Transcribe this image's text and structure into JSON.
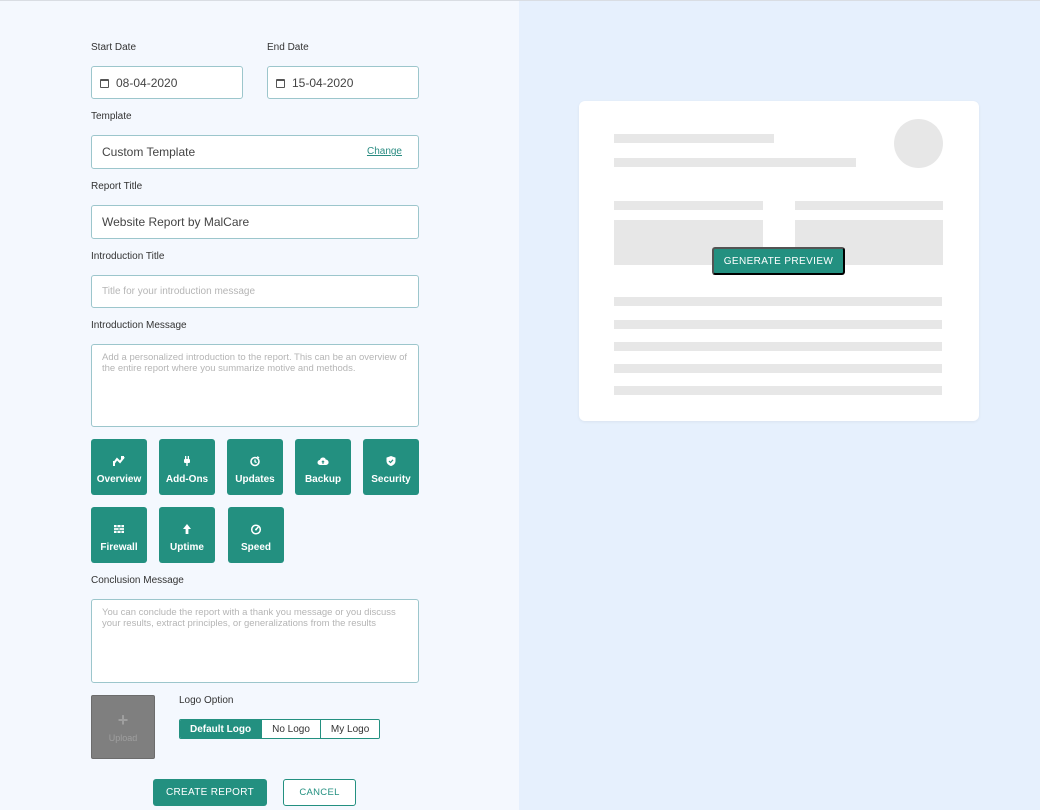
{
  "form": {
    "start_date_label": "Start Date",
    "start_date_value": "08-04-2020",
    "end_date_label": "End Date",
    "end_date_value": "15-04-2020",
    "template_label": "Template",
    "template_value": "Custom Template",
    "template_change": "Change",
    "report_title_label": "Report Title",
    "report_title_value": "Website Report by MalCare",
    "intro_title_label": "Introduction Title",
    "intro_title_placeholder": "Title for your introduction message",
    "intro_message_label": "Introduction Message",
    "intro_message_placeholder": "Add a personalized introduction to the report. This can be an overview of the entire report where you summarize motive and methods.",
    "conclusion_label": "Conclusion Message",
    "conclusion_placeholder": "You can conclude the report with a thank you message or you discuss your results, extract principles, or generalizations from the results"
  },
  "sections": [
    {
      "label": "Overview",
      "icon": "chart-icon"
    },
    {
      "label": "Add-Ons",
      "icon": "plug-icon"
    },
    {
      "label": "Updates",
      "icon": "refresh-icon"
    },
    {
      "label": "Backup",
      "icon": "cloud-icon"
    },
    {
      "label": "Security",
      "icon": "shield-icon"
    },
    {
      "label": "Firewall",
      "icon": "firewall-icon"
    },
    {
      "label": "Uptime",
      "icon": "arrow-up-icon"
    },
    {
      "label": "Speed",
      "icon": "speedometer-icon"
    }
  ],
  "logo": {
    "upload_label": "Upload",
    "option_label": "Logo Option",
    "options": [
      "Default Logo",
      "No Logo",
      "My Logo"
    ],
    "selected": "Default Logo"
  },
  "actions": {
    "create": "CREATE REPORT",
    "cancel": "CANCEL"
  },
  "preview": {
    "button": "GENERATE PREVIEW"
  },
  "colors": {
    "accent": "#239080",
    "left_bg": "#f4f8fe",
    "right_bg": "#e6f0fd",
    "field_border": "#9cc6cc"
  }
}
